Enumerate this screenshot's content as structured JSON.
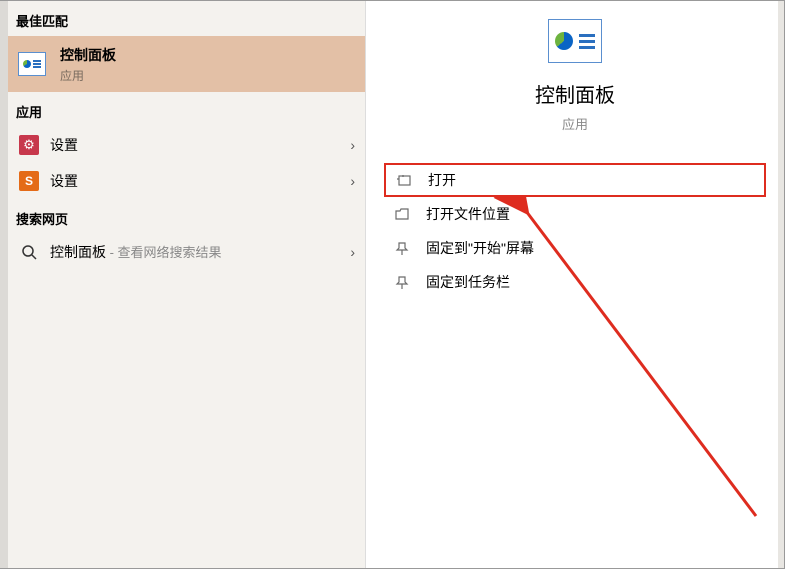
{
  "left": {
    "best_match_header": "最佳匹配",
    "best_match": {
      "title": "控制面板",
      "subtitle": "应用"
    },
    "apps_header": "应用",
    "apps": [
      {
        "label": "设置"
      },
      {
        "label": "设置"
      }
    ],
    "web_header": "搜索网页",
    "web_item": {
      "label": "控制面板",
      "suffix": " - 查看网络搜索结果"
    }
  },
  "right": {
    "title": "控制面板",
    "subtitle": "应用",
    "actions": [
      {
        "label": "打开"
      },
      {
        "label": "打开文件位置"
      },
      {
        "label": "固定到\"开始\"屏幕"
      },
      {
        "label": "固定到任务栏"
      }
    ]
  }
}
